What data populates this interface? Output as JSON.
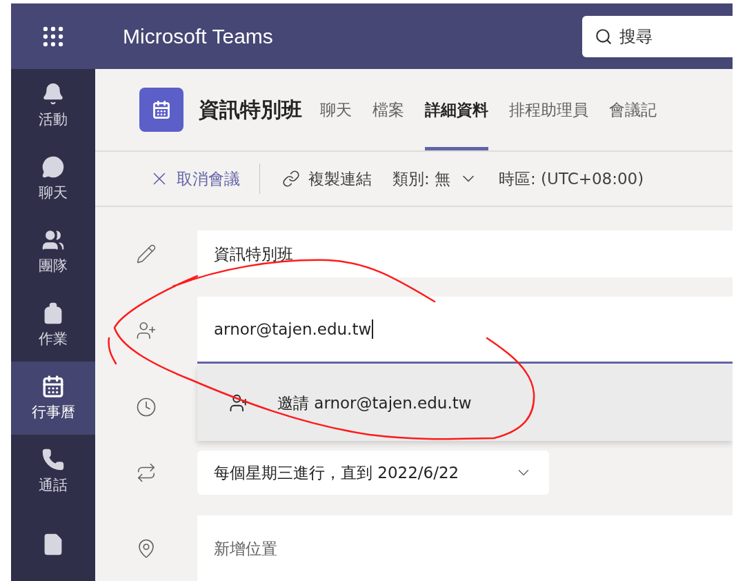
{
  "app_bar": {
    "title": "Microsoft Teams",
    "search": {
      "placeholder": "搜尋"
    }
  },
  "rail": [
    {
      "kind": "bell",
      "label": "活動",
      "selected": false
    },
    {
      "kind": "chat",
      "label": "聊天",
      "selected": false
    },
    {
      "kind": "teams",
      "label": "團隊",
      "selected": false
    },
    {
      "kind": "assignments",
      "label": "作業",
      "selected": false
    },
    {
      "kind": "calendar",
      "label": "行事曆",
      "selected": true
    },
    {
      "kind": "calls",
      "label": "通話",
      "selected": false
    },
    {
      "kind": "files",
      "selected": false
    }
  ],
  "meeting": {
    "title": "資訊特別班",
    "tabs": [
      {
        "label": "聊天",
        "selected": false
      },
      {
        "label": "檔案",
        "selected": false
      },
      {
        "label": "詳細資料",
        "selected": true
      },
      {
        "label": "排程助理員",
        "selected": false
      },
      {
        "label": "會議記",
        "selected": false
      }
    ]
  },
  "toolbar": {
    "cancel": "取消會議",
    "copy_link": "複製連結",
    "category": "類別: 無",
    "timezone": "時區: (UTC+08:00)"
  },
  "form": {
    "title_value": "資訊特別班",
    "attendees_value": "arnor@tajen.edu.tw",
    "suggestion": "邀請 arnor@tajen.edu.tw",
    "recurrence": "每個星期三進行，直到 2022/6/22",
    "location_placeholder": "新增位置"
  }
}
